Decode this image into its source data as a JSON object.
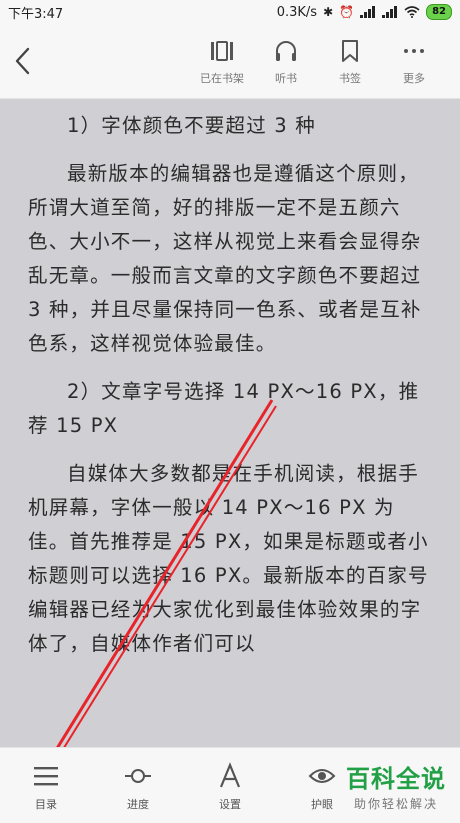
{
  "status_bar": {
    "time": "下午3:47",
    "net_speed": "0.3K/s",
    "icons": [
      "bluetooth-icon",
      "alarm-icon",
      "signal-icon",
      "signal-icon",
      "wifi-icon"
    ],
    "battery": "82"
  },
  "topbar": {
    "back_icon": "chevron-left-icon",
    "actions": [
      {
        "label": "已在书架",
        "icon": "bookshelf-icon"
      },
      {
        "label": "听书",
        "icon": "headphones-icon"
      },
      {
        "label": "书签",
        "icon": "bookmark-icon"
      },
      {
        "label": "更多",
        "icon": "more-icon"
      }
    ]
  },
  "content": {
    "paragraphs": [
      "1）字体颜色不要超过 3 种",
      "最新版本的编辑器也是遵循这个原则，所谓大道至简，好的排版一定不是五颜六色、大小不一，这样从视觉上来看会显得杂乱无章。一般而言文章的文字颜色不要超过 3 种，并且尽量保持同一色系、或者是互补色系，这样视觉体验最佳。",
      "2）文章字号选择 14 PX～16 PX，推荐 15 PX",
      "自媒体大多数都是在手机阅读，根据手机屏幕，字体一般以 14 PX～16 PX 为佳。首先推荐是 15 PX，如果是标题或者小标题则可以选择 16 PX。最新版本的百家号编辑器已经为大家优化到最佳体验效果的字体了，自媒体作者们可以"
    ],
    "annotation_color": "#e8232a"
  },
  "bottom_bar": {
    "items": [
      {
        "label": "目录",
        "icon": "menu-icon"
      },
      {
        "label": "进度",
        "icon": "progress-icon"
      },
      {
        "label": "设置",
        "icon": "font-settings-icon"
      },
      {
        "label": "护眼",
        "icon": "eye-icon"
      }
    ]
  },
  "watermark": {
    "title": "百科全说",
    "subtitle": "助你轻松解决"
  }
}
